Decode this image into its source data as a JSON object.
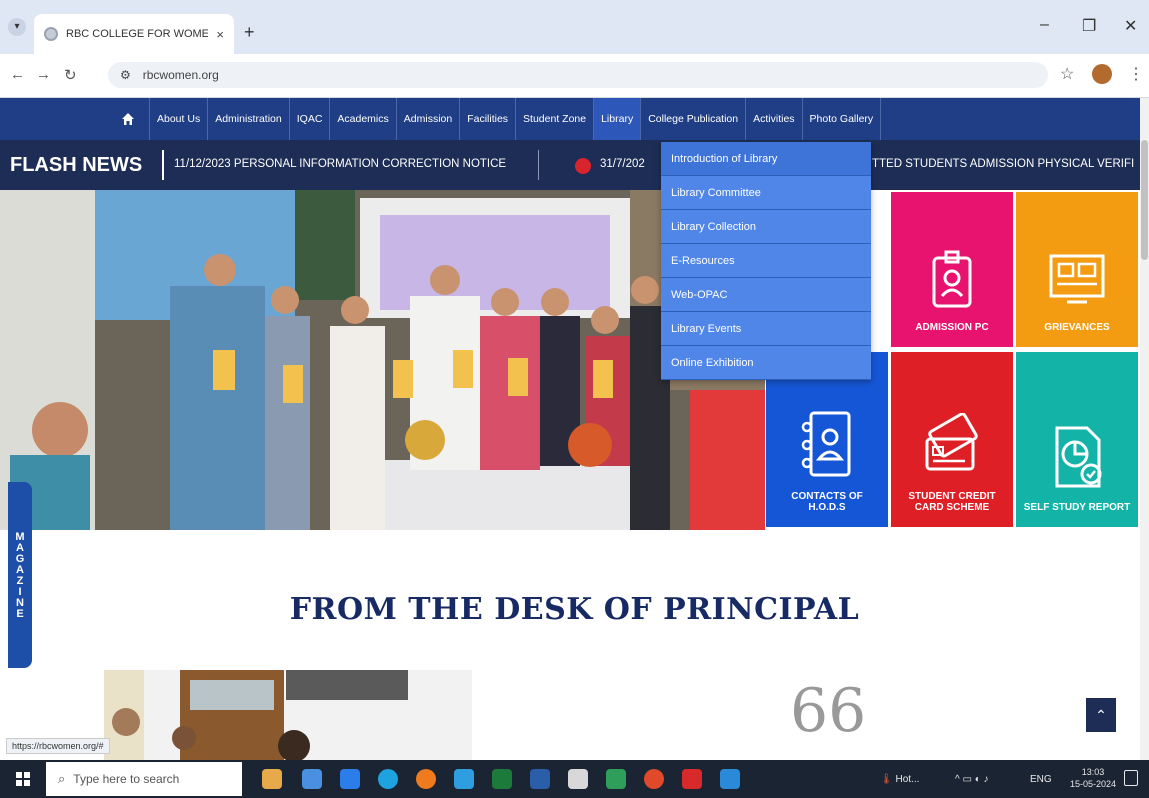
{
  "browser": {
    "tab_title": "RBC COLLEGE FOR WOMEN",
    "tab_close": "×",
    "new_tab": "+",
    "url": "rbcwomen.org",
    "status_url": "https://rbcwomen.org/#"
  },
  "nav": {
    "items": [
      "About Us",
      "Administration",
      "IQAC",
      "Academics",
      "Admission",
      "Facilities",
      "Student Zone",
      "Library",
      "College Publication",
      "Activities",
      "Photo Gallery"
    ],
    "active": "Library"
  },
  "flash": {
    "label": "FLASH NEWS",
    "item1": "11/12/2023  PERSONAL INFORMATION CORRECTION NOTICE",
    "item2_date": "31/7/202",
    "item2_tail": "TTED STUDENTS ADMISSION PHYSICAL VERIFI"
  },
  "library_menu": [
    "Introduction of Library",
    "Library Committee",
    "Library Collection",
    "E-Resources",
    "Web-OPAC",
    "Library Events",
    "Online Exhibition"
  ],
  "tiles": [
    {
      "label": "ADMISSION PC",
      "color": "#e8136f",
      "icon": "id-badge-icon"
    },
    {
      "label": "GRIEVANCES",
      "color": "#f39c12",
      "icon": "grievances-icon"
    },
    {
      "label": "CONTACTS OF H.O.D.S",
      "color": "#1556d6",
      "icon": "contact-book-icon"
    },
    {
      "label": "STUDENT CREDIT CARD SCHEME",
      "color": "#de1f26",
      "icon": "credit-card-icon"
    },
    {
      "label": "SELF STUDY REPORT",
      "color": "#14b3a8",
      "icon": "report-icon"
    }
  ],
  "magazine_label": "MAGAZINE",
  "principal_heading": "FROM THE DESK OF PRINCIPAL",
  "quote_mark": "66",
  "taskbar": {
    "search_placeholder": "Type here to search",
    "weather": "Hot...",
    "lang": "ENG",
    "time": "13:03",
    "date": "15-05-2024"
  },
  "colors": {
    "nav_bg": "#1f3e86",
    "flash_bg": "#1d2d55",
    "dropdown_bg": "#4f86e8",
    "heading": "#172a64"
  }
}
